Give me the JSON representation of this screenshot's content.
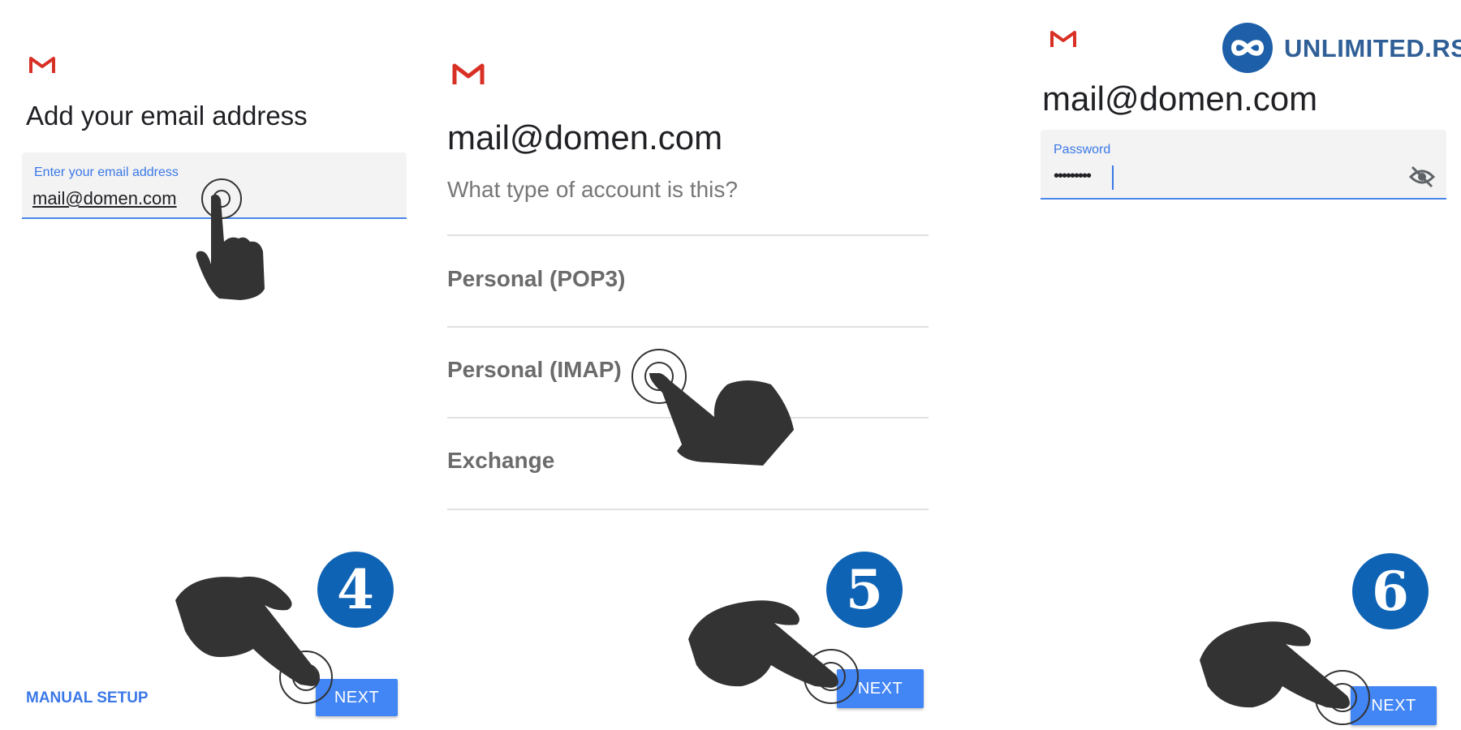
{
  "brand": {
    "name": "UNLIMITED.RS",
    "color": "#2f5f96"
  },
  "colors": {
    "accent": "#4285f4",
    "badge": "#0f63b4",
    "gmail_red": "#d93025"
  },
  "panel1": {
    "title": "Add your email address",
    "email_label": "Enter your email address",
    "email_value": "mail@domen.com",
    "manual_setup_label": "MANUAL SETUP",
    "next_label": "NEXT",
    "step_number": "4"
  },
  "panel2": {
    "title": "mail@domen.com",
    "subtitle": "What type of account is this?",
    "options": [
      "Personal (POP3)",
      "Personal (IMAP)",
      "Exchange"
    ],
    "next_label": "NEXT",
    "step_number": "5"
  },
  "panel3": {
    "title": "mail@domen.com",
    "password_label": "Password",
    "password_value": "•••••••••",
    "next_label": "NEXT",
    "step_number": "6"
  },
  "icons": [
    "gmail-icon",
    "hand-pointer-icon",
    "eye-off-icon",
    "infinity-logo-icon"
  ]
}
